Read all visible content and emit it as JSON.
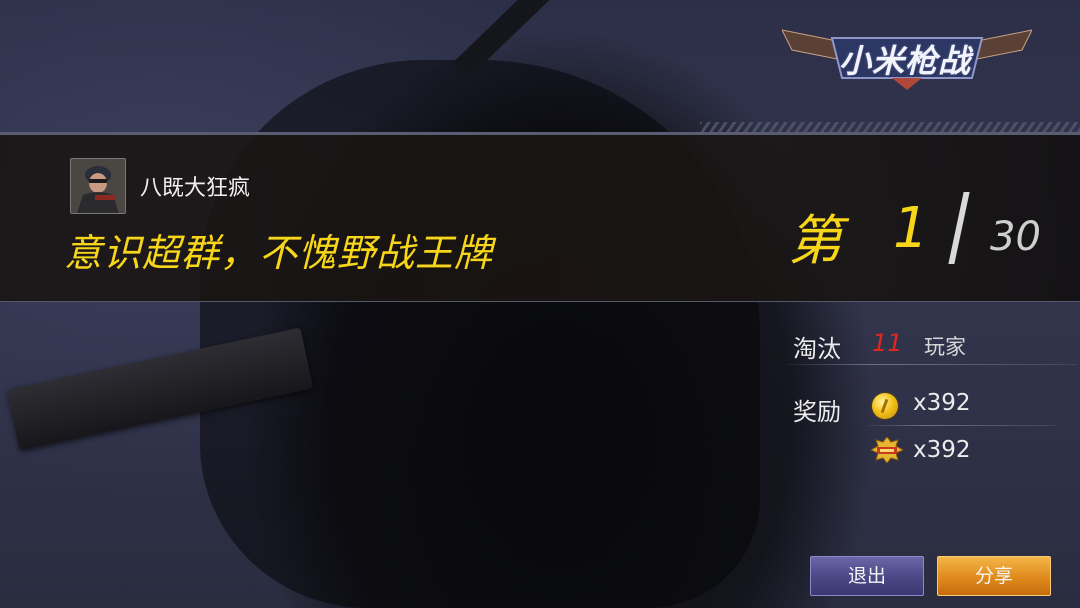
{
  "logo": {
    "text": "小米枪战"
  },
  "player": {
    "name": "八既大狂疯",
    "avatar_icon": "soldier-avatar"
  },
  "result": {
    "title": "意识超群，不愧野战王牌",
    "rank_label": "第",
    "rank": "1",
    "total": "30"
  },
  "stats": {
    "kills_label": "淘汰",
    "kills": "11",
    "kills_unit": "玩家",
    "reward_label": "奖励",
    "rewards": [
      {
        "icon": "gold-coin-icon",
        "amount": "x392"
      },
      {
        "icon": "experience-badge-icon",
        "amount": "x392"
      }
    ]
  },
  "buttons": {
    "exit": "退出",
    "share": "分享"
  },
  "colors": {
    "highlight": "#f7d61a",
    "kills": "#e0261d",
    "exit_button": "#4d4a88",
    "share_button": "#e08a1d"
  }
}
